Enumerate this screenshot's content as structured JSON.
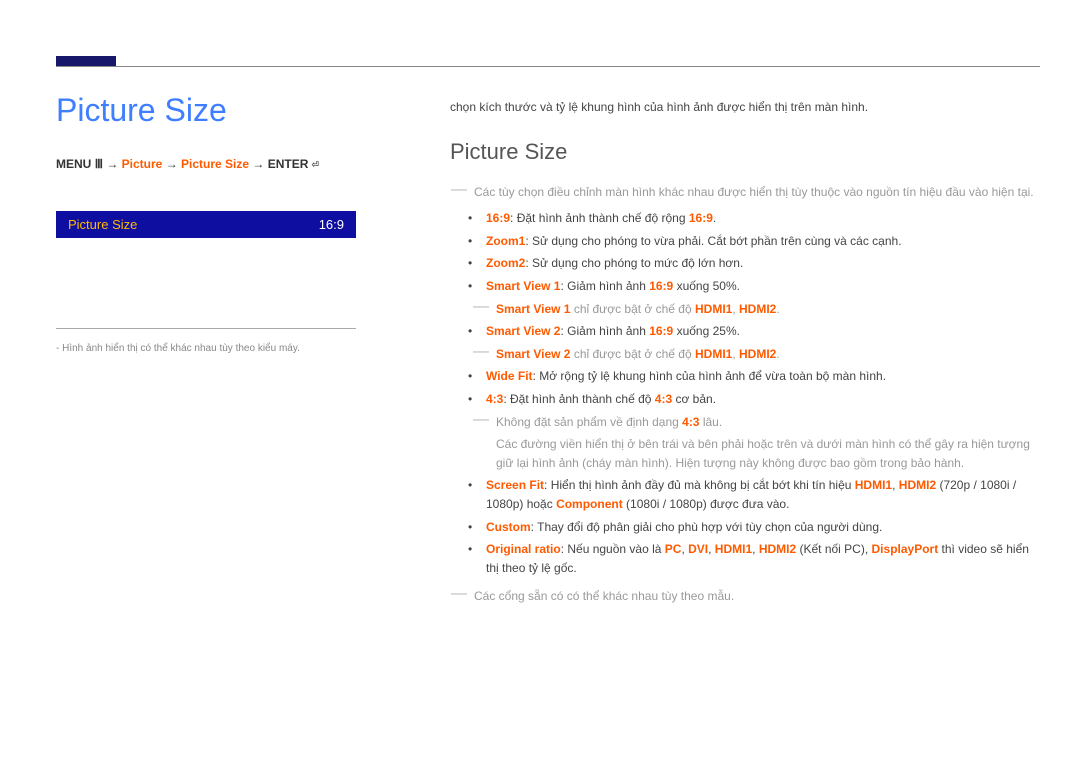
{
  "left": {
    "title": "Picture Size",
    "breadcrumb": {
      "menu": "MENU",
      "menu_icon": "Ⅲ",
      "arrow": " → ",
      "picture": "Picture",
      "picture_size": "Picture Size",
      "enter": "ENTER",
      "enter_icon": "⏎"
    },
    "menu_box": {
      "label": "Picture Size",
      "value": "16:9"
    },
    "note_prefix": "-",
    "note": "Hình ảnh hiển thị có thể khác nhau tùy theo kiểu máy."
  },
  "right": {
    "intro": "chọn kích thước và tỷ lệ khung hình của hình ảnh được hiển thị trên màn hình.",
    "section_title": "Picture Size",
    "top_note": "Các tùy chọn điều chỉnh màn hình khác nhau được hiển thị tùy thuộc vào nguồn tín hiệu đầu vào hiện tại.",
    "opt_16_9_k": "16:9",
    "opt_16_9_t_a": ": Đặt hình ảnh thành chế độ rộng ",
    "opt_16_9_t_b": "16:9",
    "opt_16_9_t_c": ".",
    "opt_zoom1_k": "Zoom1",
    "opt_zoom1_t": ": Sử dụng cho phóng to vừa phải. Cắt bớt phần trên cùng và các cạnh.",
    "opt_zoom2_k": "Zoom2",
    "opt_zoom2_t": ": Sử dụng cho phóng to mức độ lớn hơn.",
    "opt_sv1_k": "Smart View 1",
    "opt_sv1_t_a": ": Giảm hình ảnh ",
    "opt_sv1_t_b": "16:9",
    "opt_sv1_t_c": " xuống 50%.",
    "sub_sv1_a": "Smart View 1",
    "sub_sv1_b": " chỉ được bật ở chế độ ",
    "sub_sv1_c": "HDMI1",
    "sub_sv1_d": ", ",
    "sub_sv1_e": "HDMI2",
    "sub_sv1_f": ".",
    "opt_sv2_k": "Smart View 2",
    "opt_sv2_t_a": ": Giảm hình ảnh ",
    "opt_sv2_t_b": "16:9",
    "opt_sv2_t_c": " xuống 25%.",
    "sub_sv2_a": "Smart View 2",
    "sub_sv2_b": " chỉ được bật ở chế độ ",
    "sub_sv2_c": "HDMI1",
    "sub_sv2_d": ", ",
    "sub_sv2_e": "HDMI2",
    "sub_sv2_f": ".",
    "opt_wf_k": "Wide Fit",
    "opt_wf_t": ": Mở rộng tỷ lệ khung hình của hình ảnh để vừa toàn bộ màn hình.",
    "opt_43_k": "4:3",
    "opt_43_t_a": ": Đặt hình ảnh thành chế độ ",
    "opt_43_t_b": "4:3",
    "opt_43_t_c": " cơ bản.",
    "sub_43a_a": "Không đặt sản phẩm về định dạng ",
    "sub_43a_b": "4:3",
    "sub_43a_c": " lâu.",
    "sub_43b": "Các đường viền hiển thị ở bên trái và bên phải hoặc trên và dưới màn hình có thể gây ra hiện tượng giữ lại hình ảnh (cháy màn hình). Hiện tượng này không được bao gồm trong bảo hành.",
    "opt_sf_k": "Screen Fit",
    "opt_sf_t_a": ": Hiển thị hình ảnh đầy đủ mà không bị cắt bớt khi tín hiệu ",
    "opt_sf_t_b": "HDMI1",
    "opt_sf_t_c": ", ",
    "opt_sf_t_d": "HDMI2",
    "opt_sf_t_e": " (720p / 1080i / 1080p) hoặc ",
    "opt_sf_t_f": "Component",
    "opt_sf_t_g": " (1080i / 1080p) được đưa vào.",
    "opt_cu_k": "Custom",
    "opt_cu_t": ": Thay đổi độ phân giải cho phù hợp với tùy chọn của người dùng.",
    "opt_or_k": "Original ratio",
    "opt_or_t_a": ": Nếu nguồn vào là ",
    "opt_or_t_b": "PC",
    "opt_or_t_c": ", ",
    "opt_or_t_d": "DVI",
    "opt_or_t_e": ", ",
    "opt_or_t_f": "HDMI1",
    "opt_or_t_g": ", ",
    "opt_or_t_h": "HDMI2",
    "opt_or_t_i": " (Kết nối PC), ",
    "opt_or_t_j": "DisplayPort",
    "opt_or_t_k": " thì video sẽ hiển thị theo tỷ lệ gốc.",
    "bottom_note": "Các cổng sẵn có có thể khác nhau tùy theo mẫu."
  }
}
